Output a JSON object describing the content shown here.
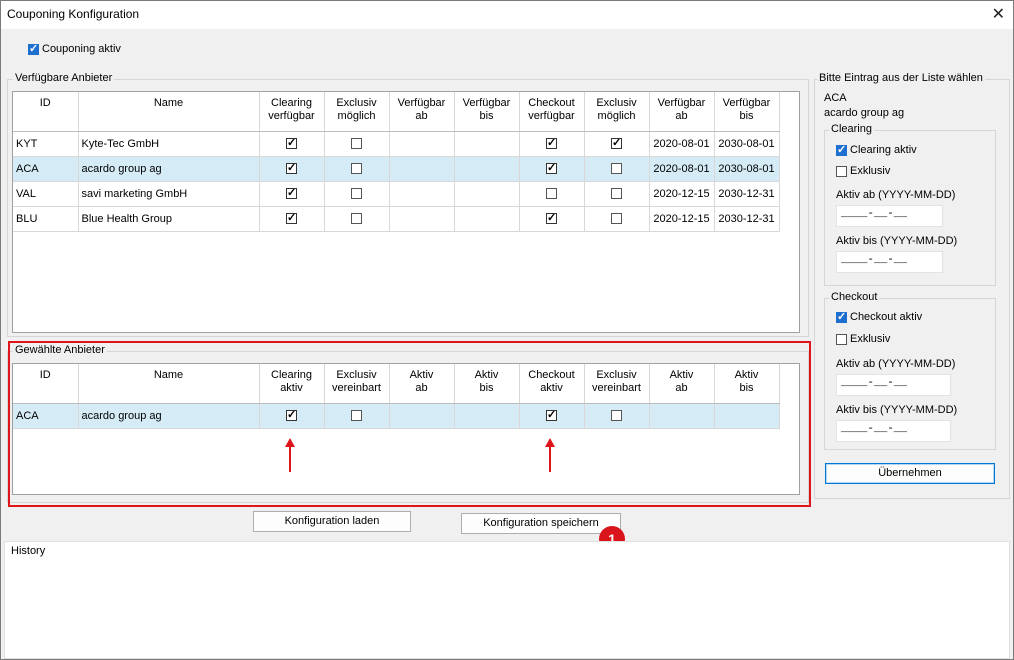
{
  "window": {
    "title": "Couponing Konfiguration"
  },
  "couponing_active": {
    "label": "Couponing aktiv",
    "checked": true
  },
  "available": {
    "group_label": "Verfügbare Anbieter",
    "columns": [
      "ID",
      "Name",
      "Clearing\nverfügbar",
      "Exclusiv\nmöglich",
      "Verfügbar\nab",
      "Verfügbar\nbis",
      "Checkout\nverfügbar",
      "Exclusiv\nmöglich",
      "Verfügbar\nab",
      "Verfügbar\nbis"
    ],
    "rows": [
      {
        "id": "KYT",
        "name": "Kyte-Tec GmbH",
        "clearing": true,
        "excl1": false,
        "ab1": "",
        "bis1": "",
        "checkout": true,
        "excl2": true,
        "ab2": "2020-08-01",
        "bis2": "2030-08-01",
        "selected": false
      },
      {
        "id": "ACA",
        "name": "acardo group ag",
        "clearing": true,
        "excl1": false,
        "ab1": "",
        "bis1": "",
        "checkout": true,
        "excl2": false,
        "ab2": "2020-08-01",
        "bis2": "2030-08-01",
        "selected": true
      },
      {
        "id": "VAL",
        "name": "savi marketing GmbH",
        "clearing": true,
        "excl1": false,
        "ab1": "",
        "bis1": "",
        "checkout": false,
        "excl2": false,
        "ab2": "2020-12-15",
        "bis2": "2030-12-31",
        "selected": false
      },
      {
        "id": "BLU",
        "name": "Blue Health Group",
        "clearing": true,
        "excl1": false,
        "ab1": "",
        "bis1": "",
        "checkout": true,
        "excl2": false,
        "ab2": "2020-12-15",
        "bis2": "2030-12-31",
        "selected": false
      }
    ]
  },
  "selected": {
    "group_label": "Gewählte Anbieter",
    "columns": [
      "ID",
      "Name",
      "Clearing\naktiv",
      "Exclusiv\nvereinbart",
      "Aktiv\nab",
      "Aktiv\nbis",
      "Checkout\naktiv",
      "Exclusiv\nvereinbart",
      "Aktiv\nab",
      "Aktiv\nbis"
    ],
    "rows": [
      {
        "id": "ACA",
        "name": "acardo group ag",
        "clearing": true,
        "excl1": false,
        "ab1": "",
        "bis1": "",
        "checkout": true,
        "excl2": false,
        "ab2": "",
        "bis2": "",
        "selected": true
      }
    ]
  },
  "buttons": {
    "load": "Konfiguration laden",
    "save": "Konfiguration speichern",
    "apply": "Übernehmen"
  },
  "badge": "1",
  "history": {
    "label": "History"
  },
  "right_panel": {
    "header": "Bitte Eintrag aus der Liste wählen",
    "id": "ACA",
    "name": "acardo group ag",
    "clearing": {
      "label": "Clearing",
      "active_label": "Clearing aktiv",
      "active": true,
      "exclusive_label": "Exklusiv",
      "exclusive": false,
      "from_label": "Aktiv ab (YYYY-MM-DD)",
      "from_value": "____-__-__",
      "to_label": "Aktiv bis (YYYY-MM-DD)",
      "to_value": "____-__-__"
    },
    "checkout": {
      "label": "Checkout",
      "active_label": "Checkout aktiv",
      "active": true,
      "exclusive_label": "Exklusiv",
      "exclusive": false,
      "from_label": "Aktiv ab (YYYY-MM-DD)",
      "from_value": "____-__-__",
      "to_label": "Aktiv bis (YYYY-MM-DD)",
      "to_value": "____-__-__"
    }
  },
  "colors": {
    "accent": "#1f6fd1",
    "selection": "#d5ecf7",
    "highlight": "#e0141b"
  },
  "icons": {
    "close": "close-icon",
    "check": "checkmark-icon",
    "arrow": "arrow-up-icon"
  }
}
